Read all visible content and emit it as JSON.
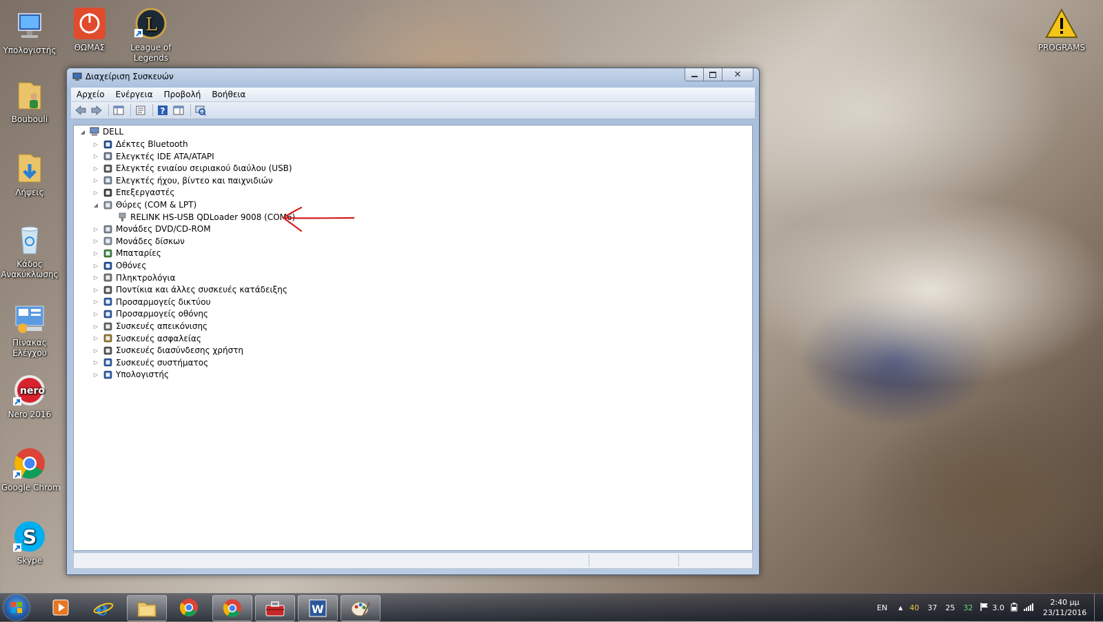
{
  "desktop": {
    "icons": [
      {
        "label": "Υπολογιστής"
      },
      {
        "label": "ΘΩΜΑΣ"
      },
      {
        "label": "League of Legends"
      },
      {
        "label": "Boubouli"
      },
      {
        "label": "Λήψεις"
      },
      {
        "label": "Κάδος Ανακύκλωσης"
      },
      {
        "label": "Πίνακας Ελέγχου"
      },
      {
        "label": "Nero 2016"
      },
      {
        "label": "Google Chrome S"
      },
      {
        "label": "Skype"
      },
      {
        "label": "PROGRAMS"
      }
    ]
  },
  "window": {
    "title": "Διαχείριση Συσκευών",
    "menu": [
      "Αρχείο",
      "Ενέργεια",
      "Προβολή",
      "Βοήθεια"
    ],
    "tree": {
      "root": "DELL",
      "categories": [
        {
          "label": "Δέκτες Bluetooth",
          "expanded": false
        },
        {
          "label": "Ελεγκτές IDE ATA/ATAPI",
          "expanded": false
        },
        {
          "label": "Ελεγκτές ενιαίου σειριακού διαύλου (USB)",
          "expanded": false
        },
        {
          "label": "Ελεγκτές ήχου, βίντεο και παιχνιδιών",
          "expanded": false
        },
        {
          "label": "Επεξεργαστές",
          "expanded": false
        },
        {
          "label": "Θύρες (COM & LPT)",
          "expanded": true,
          "children": [
            "RELINK HS-USB QDLoader 9008 (COM6)"
          ]
        },
        {
          "label": "Μονάδες DVD/CD-ROM",
          "expanded": false
        },
        {
          "label": "Μονάδες δίσκων",
          "expanded": false
        },
        {
          "label": "Μπαταρίες",
          "expanded": false
        },
        {
          "label": "Οθόνες",
          "expanded": false
        },
        {
          "label": "Πληκτρολόγια",
          "expanded": false
        },
        {
          "label": "Ποντίκια και άλλες συσκευές κατάδειξης",
          "expanded": false
        },
        {
          "label": "Προσαρμογείς δικτύου",
          "expanded": false
        },
        {
          "label": "Προσαρμογείς οθόνης",
          "expanded": false
        },
        {
          "label": "Συσκευές απεικόνισης",
          "expanded": false
        },
        {
          "label": "Συσκευές ασφαλείας",
          "expanded": false
        },
        {
          "label": "Συσκευές διασύνδεσης χρήστη",
          "expanded": false
        },
        {
          "label": "Συσκευές συστήματος",
          "expanded": false
        },
        {
          "label": "Υπολογιστής",
          "expanded": false
        }
      ]
    },
    "annotation_color": "#d11c1c"
  },
  "taskbar": {
    "apps": [
      "windows-media-player",
      "internet-explorer",
      "file-explorer",
      "google-chrome",
      "google-chrome",
      "toolbox",
      "microsoft-word",
      "paint"
    ],
    "tray": {
      "language": "EN",
      "numbers": [
        "40",
        "37",
        "25",
        "32"
      ],
      "number_colors": [
        "#f3c54a",
        "#ffffff",
        "#ffffff",
        "#5fe07a"
      ],
      "version": "3.0",
      "time": "2:40 μμ",
      "date": "23/11/2016"
    }
  }
}
